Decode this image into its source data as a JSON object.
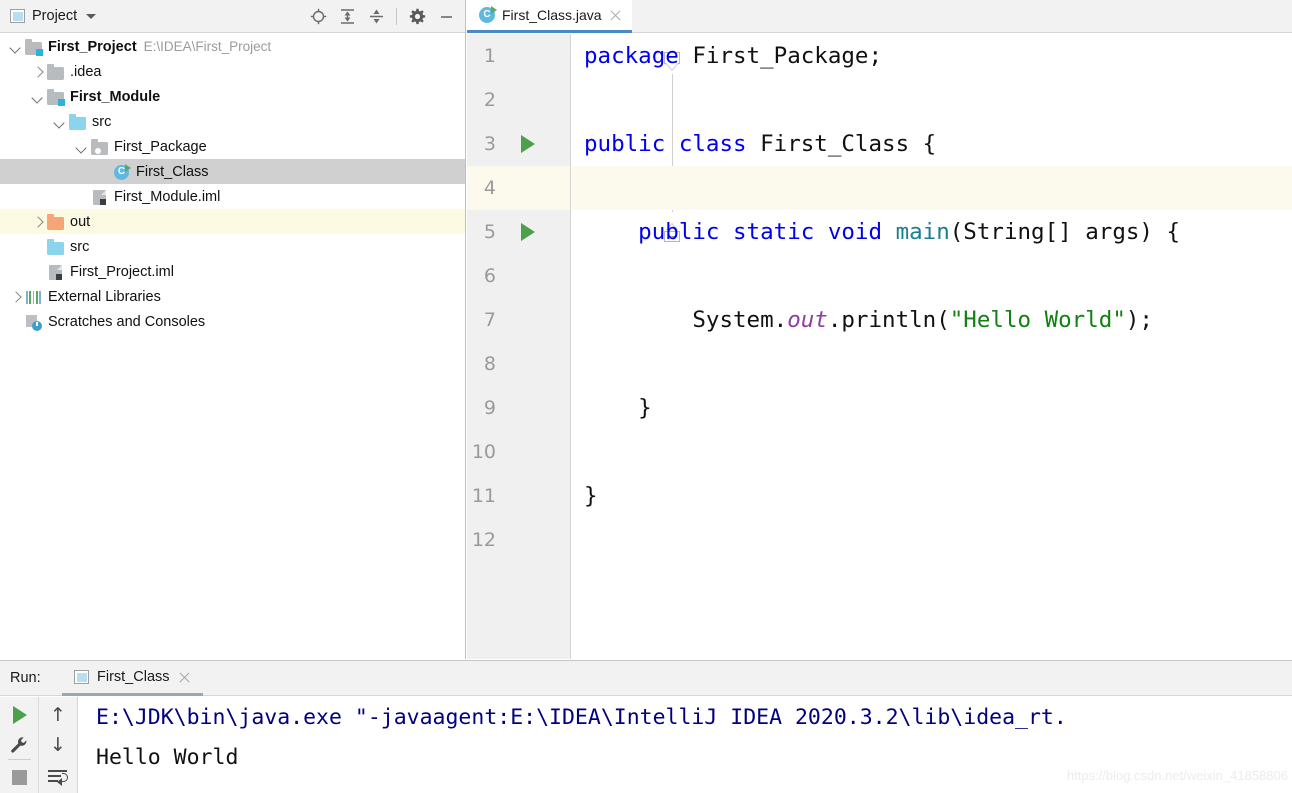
{
  "project_panel": {
    "title": "Project",
    "window_icon": "project-window-icon",
    "dropdown_icon": "chevron-down-icon",
    "toolbar": [
      {
        "name": "locate-icon",
        "label": "Select Opened File"
      },
      {
        "name": "expand-all-icon",
        "label": "Expand All"
      },
      {
        "name": "collapse-all-icon",
        "label": "Collapse All"
      },
      {
        "name": "gear-icon",
        "label": "Settings"
      },
      {
        "name": "minimize-icon",
        "label": "Hide"
      }
    ],
    "tree": [
      {
        "label": "First_Project",
        "path": "E:\\IDEA\\First_Project",
        "icon": "project-folder-icon",
        "indent": 0,
        "twist": "down",
        "bold": true,
        "state": "normal"
      },
      {
        "label": ".idea",
        "path": "",
        "icon": "folder-gray-icon",
        "indent": 1,
        "twist": "right",
        "bold": false,
        "state": "normal"
      },
      {
        "label": "First_Module",
        "path": "",
        "icon": "module-folder-icon",
        "indent": 1,
        "twist": "down",
        "bold": true,
        "state": "normal"
      },
      {
        "label": "src",
        "path": "",
        "icon": "source-folder-icon",
        "indent": 2,
        "twist": "down",
        "bold": false,
        "state": "normal"
      },
      {
        "label": "First_Package",
        "path": "",
        "icon": "package-folder-icon",
        "indent": 3,
        "twist": "down",
        "bold": false,
        "state": "normal"
      },
      {
        "label": "First_Class",
        "path": "",
        "icon": "java-class-icon",
        "indent": 4,
        "twist": "none",
        "bold": false,
        "state": "selected"
      },
      {
        "label": "First_Module.iml",
        "path": "",
        "icon": "iml-file-icon",
        "indent": 3,
        "twist": "none",
        "bold": false,
        "state": "normal"
      },
      {
        "label": "out",
        "path": "",
        "icon": "output-folder-icon",
        "indent": 1,
        "twist": "right",
        "bold": false,
        "state": "highlighted"
      },
      {
        "label": "src",
        "path": "",
        "icon": "source-folder-icon",
        "indent": 1,
        "twist": "none",
        "bold": false,
        "state": "normal"
      },
      {
        "label": "First_Project.iml",
        "path": "",
        "icon": "iml-file-icon",
        "indent": 1,
        "twist": "none",
        "bold": false,
        "state": "normal"
      },
      {
        "label": "External Libraries",
        "path": "",
        "icon": "libraries-icon",
        "indent": 0,
        "twist": "right",
        "bold": false,
        "state": "normal"
      },
      {
        "label": "Scratches and Consoles",
        "path": "",
        "icon": "scratches-icon",
        "indent": 0,
        "twist": "none",
        "bold": false,
        "state": "normal"
      }
    ]
  },
  "editor": {
    "tab": {
      "label": "First_Class.java",
      "icon": "java-class-icon",
      "close_icon": "close-icon",
      "active": true
    },
    "lines": [
      {
        "num": "1",
        "run_marker": false,
        "caret": false,
        "tokens": [
          {
            "t": "package ",
            "c": "kw"
          },
          {
            "t": "First_Package;",
            "c": "pln"
          }
        ]
      },
      {
        "num": "2",
        "run_marker": false,
        "caret": false,
        "tokens": []
      },
      {
        "num": "3",
        "run_marker": true,
        "caret": false,
        "tokens": [
          {
            "t": "public ",
            "c": "kw"
          },
          {
            "t": "class ",
            "c": "kw"
          },
          {
            "t": "First_Class {",
            "c": "cls-name"
          }
        ]
      },
      {
        "num": "4",
        "run_marker": false,
        "caret": true,
        "tokens": []
      },
      {
        "num": "5",
        "run_marker": true,
        "caret": false,
        "tokens": [
          {
            "t": "    public ",
            "c": "kw"
          },
          {
            "t": "static ",
            "c": "kw"
          },
          {
            "t": "void ",
            "c": "kw"
          },
          {
            "t": "main",
            "c": "mth"
          },
          {
            "t": "(String[] args) {",
            "c": "pln"
          }
        ]
      },
      {
        "num": "6",
        "run_marker": false,
        "caret": false,
        "tokens": []
      },
      {
        "num": "7",
        "run_marker": false,
        "caret": false,
        "tokens": [
          {
            "t": "        System.",
            "c": "pln"
          },
          {
            "t": "out",
            "c": "fld"
          },
          {
            "t": ".println(",
            "c": "pln"
          },
          {
            "t": "\"Hello World\"",
            "c": "str"
          },
          {
            "t": ");",
            "c": "pln"
          }
        ]
      },
      {
        "num": "8",
        "run_marker": false,
        "caret": false,
        "tokens": []
      },
      {
        "num": "9",
        "run_marker": false,
        "caret": false,
        "tokens": [
          {
            "t": "    }",
            "c": "pln"
          }
        ]
      },
      {
        "num": "10",
        "run_marker": false,
        "caret": false,
        "tokens": []
      },
      {
        "num": "11",
        "run_marker": false,
        "caret": false,
        "tokens": [
          {
            "t": "}",
            "c": "pln"
          }
        ]
      },
      {
        "num": "12",
        "run_marker": false,
        "caret": false,
        "tokens": []
      }
    ],
    "colors": {
      "keyword": "#0000ee",
      "method": "#1a7e8e",
      "field": "#8f3f9e",
      "string": "#128012",
      "plain": "#111111",
      "caret_line": "#fcfaec",
      "gutter": "#f0f0f0",
      "run_marker": "#4ca04c",
      "tab_underline": "#4a88c7"
    }
  },
  "run_panel": {
    "label": "Run:",
    "tab": {
      "label": "First_Class",
      "icon": "run-config-icon",
      "close_icon": "close-icon"
    },
    "toolbar": [
      {
        "name": "rerun-icon",
        "label": "Rerun"
      },
      {
        "name": "up-arrow-icon",
        "label": "Previous Occurrence"
      },
      {
        "name": "wrench-icon",
        "label": "Edit Configuration"
      },
      {
        "name": "down-arrow-icon",
        "label": "Next Occurrence"
      },
      {
        "name": "stop-icon",
        "label": "Stop"
      },
      {
        "name": "soft-wrap-icon",
        "label": "Soft-Wrap"
      }
    ],
    "console": {
      "command": "E:\\JDK\\bin\\java.exe \"-javaagent:E:\\IDEA\\IntelliJ IDEA 2020.3.2\\lib\\idea_rt.",
      "output": "Hello World",
      "command_color": "#000080"
    }
  },
  "watermark": "https://blog.csdn.net/weixin_41858806"
}
